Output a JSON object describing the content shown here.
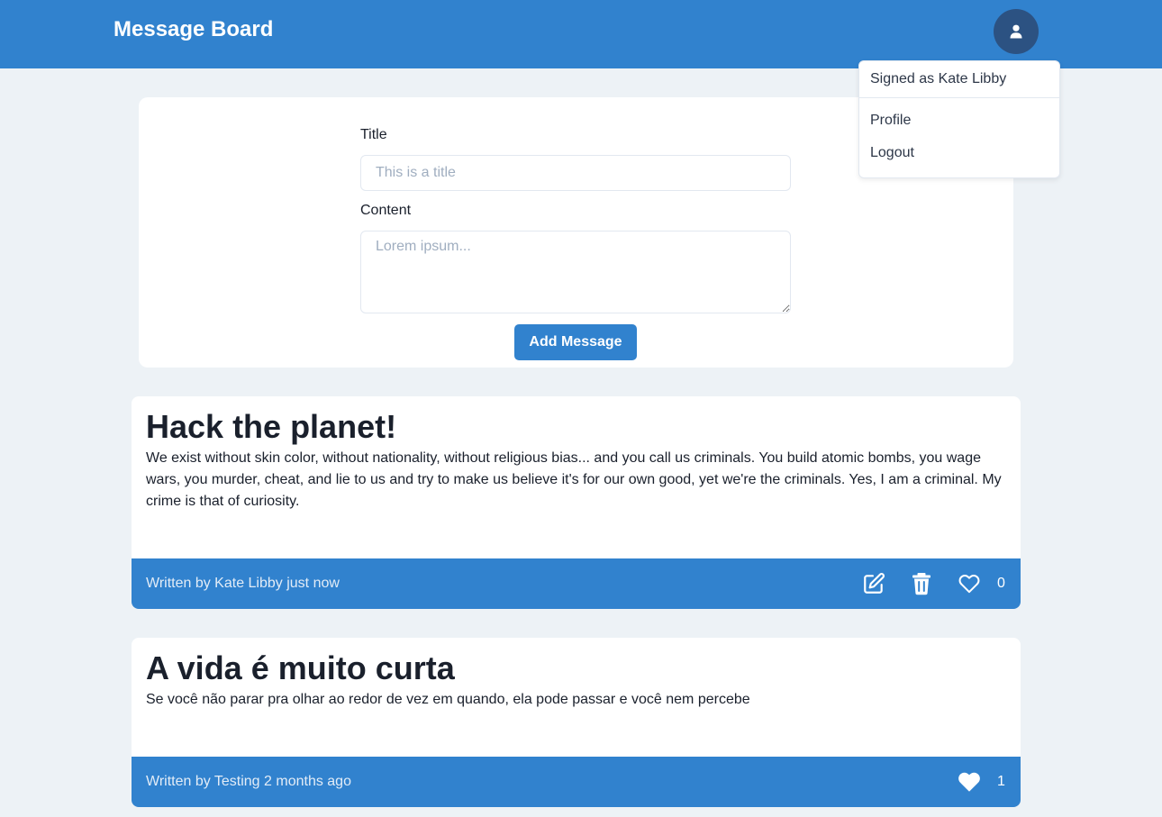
{
  "header": {
    "brand": "Message Board",
    "avatar_icon": "user-icon"
  },
  "user_menu": {
    "signed_as": "Signed as Kate Libby",
    "items": [
      {
        "label": "Profile"
      },
      {
        "label": "Logout"
      }
    ]
  },
  "form": {
    "title_label": "Title",
    "title_placeholder": "This is a title",
    "title_value": "",
    "content_label": "Content",
    "content_placeholder": "Lorem ipsum...",
    "content_value": "",
    "submit_label": "Add Message"
  },
  "posts": [
    {
      "title": "Hack the planet!",
      "body": "We exist without skin color, without nationality, without religious bias... and you call us criminals. You build atomic bombs, you wage wars, you murder, cheat, and lie to us and try to make us believe it's for our own good, yet we're the criminals. Yes, I am a criminal. My crime is that of curiosity.",
      "meta": "Written by Kate Libby just now",
      "likes": "0",
      "liked": false,
      "actions": [
        "edit-icon",
        "trash-icon",
        "heart-outline-icon"
      ]
    },
    {
      "title": "A vida é muito curta",
      "body": "Se você não parar pra olhar ao redor de vez em quando, ela pode passar e você nem percebe",
      "meta": "Written by Testing 2 months ago",
      "likes": "1",
      "liked": true,
      "actions": [
        "heart-filled-icon"
      ]
    }
  ],
  "colors": {
    "primary": "#3182ce",
    "avatar_bg": "#2c5282",
    "page_bg": "#edf2f6"
  }
}
